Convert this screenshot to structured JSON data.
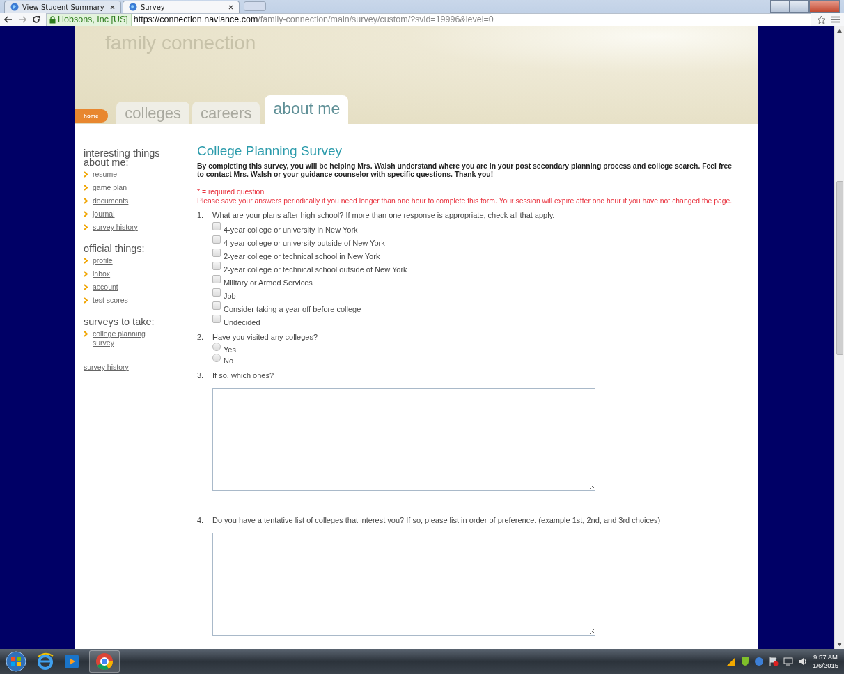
{
  "browser": {
    "tabs": [
      {
        "title": "View Student Summary",
        "selected": false
      },
      {
        "title": "Survey",
        "selected": true
      }
    ],
    "address": {
      "site_badge": "Hobsons, Inc [US]",
      "url_host": "https://connection.naviance.com",
      "url_path": "/family-connection/main/survey/custom/?svid=19996&level=0"
    }
  },
  "site": {
    "logo": "family connection",
    "home_badge": "home",
    "tabs": [
      {
        "label": "colleges",
        "selected": false
      },
      {
        "label": "careers",
        "selected": false
      },
      {
        "label": "about me",
        "selected": true
      }
    ]
  },
  "sidebar": {
    "sections": [
      {
        "heading": "interesting things about me:",
        "links": [
          "resume",
          "game plan",
          "documents",
          "journal",
          "survey history"
        ]
      },
      {
        "heading": "official things:",
        "links": [
          "profile",
          "inbox",
          "account",
          "test scores"
        ]
      },
      {
        "heading": "surveys to take:",
        "links": [
          "college planning survey"
        ]
      }
    ],
    "extra_link": "survey history"
  },
  "survey": {
    "title": "College Planning Survey",
    "intro": "By completing this survey, you will be helping Mrs. Walsh understand where you are in your post secondary planning process and college search. Feel free to contact Mrs. Walsh or your guidance counselor with specific questions. Thank you!",
    "required_note": "* = required question",
    "warning": "Please save your answers periodically if you need longer than one hour to complete this form. Your session will expire after one hour if you have not changed the page.",
    "questions": [
      {
        "number": "1.",
        "text": "What are your plans after high school? If more than one response is appropriate, check all that apply.",
        "kind": "checkboxes",
        "options": [
          {
            "label": "4-year college or university in New York",
            "checked": false
          },
          {
            "label": "4-year college or university outside of New York",
            "checked": false
          },
          {
            "label": "2-year college or technical school in New York",
            "checked": false
          },
          {
            "label": "2-year college or technical school outside of New York",
            "checked": false
          },
          {
            "label": "Military or Armed Services",
            "checked": false
          },
          {
            "label": "Job",
            "checked": false
          },
          {
            "label": "Consider taking a year off before college",
            "checked": false
          },
          {
            "label": "Undecided",
            "checked": false
          }
        ]
      },
      {
        "number": "2.",
        "text": "Have you visited any colleges?",
        "kind": "radios",
        "options": [
          {
            "label": "Yes",
            "selected": false
          },
          {
            "label": "No",
            "selected": false
          }
        ]
      },
      {
        "number": "3.",
        "text": "If so, which ones?",
        "kind": "textarea"
      },
      {
        "number": "4.",
        "text": "Do you have a tentative list of colleges that interest you? If so, please list in order of preference. (example 1st, 2nd, and 3rd choices)",
        "kind": "textarea"
      }
    ]
  },
  "taskbar": {
    "time": "9:57 AM",
    "date": "1/6/2015"
  }
}
